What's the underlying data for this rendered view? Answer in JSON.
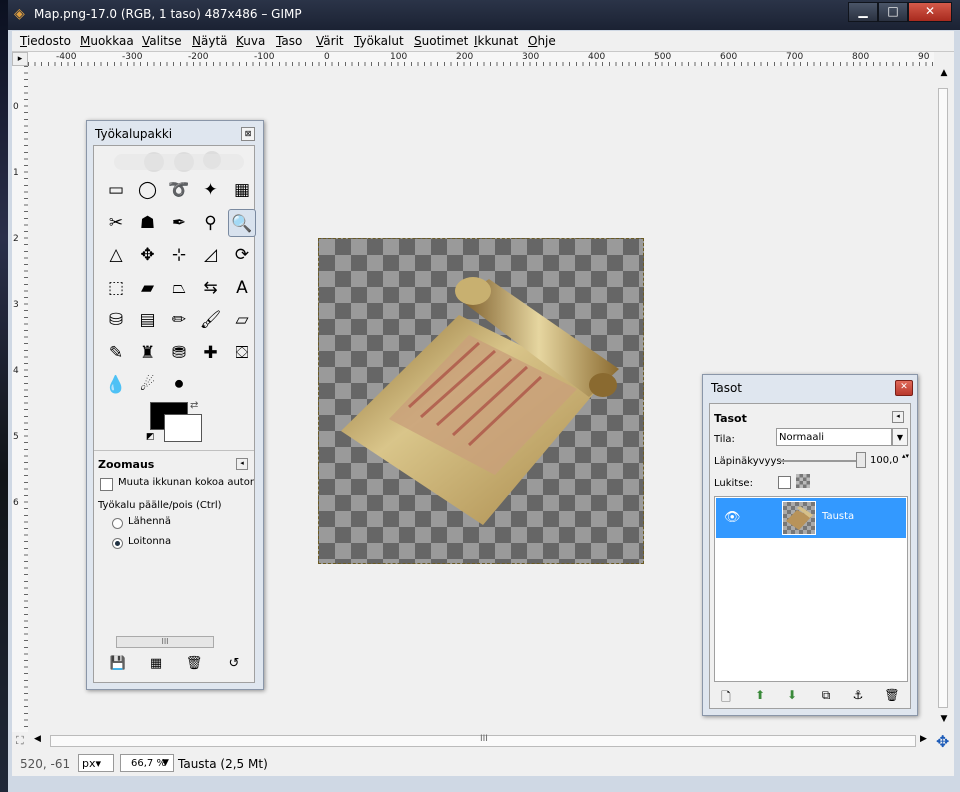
{
  "window": {
    "title": "Map.png-17.0 (RGB, 1 taso) 487x486 – GIMP",
    "minimize": "▁",
    "maximize": "□",
    "close": "✕"
  },
  "menu": [
    "Tiedosto",
    "Muokkaa",
    "Valitse",
    "Näytä",
    "Kuva",
    "Taso",
    "Värit",
    "Työkalut",
    "Suotimet",
    "Ikkunat",
    "Ohje"
  ],
  "ruler": {
    "h_labels": [
      "-400",
      "-300",
      "-200",
      "-100",
      "0",
      "100",
      "200",
      "300",
      "400",
      "500",
      "600",
      "700",
      "800",
      "90"
    ],
    "v_labels": [
      "0",
      "1",
      "2",
      "3",
      "4",
      "5",
      "6"
    ]
  },
  "status": {
    "coords": "520, -61",
    "unit": "px▾",
    "zoom": "66,7 %",
    "text": "Tausta (2,5 Mt)"
  },
  "toolbox": {
    "title": "Työkalupakki",
    "close": "⊠",
    "tools": [
      {
        "name": "rect-select-icon",
        "glyph": "▭"
      },
      {
        "name": "ellipse-select-icon",
        "glyph": "◯"
      },
      {
        "name": "free-select-icon",
        "glyph": "➰"
      },
      {
        "name": "fuzzy-select-icon",
        "glyph": "✦"
      },
      {
        "name": "color-select-icon",
        "glyph": "▦"
      },
      {
        "name": "scissors-icon",
        "glyph": "✂"
      },
      {
        "name": "foreground-select-icon",
        "glyph": "☗"
      },
      {
        "name": "paths-icon",
        "glyph": "✒"
      },
      {
        "name": "color-picker-icon",
        "glyph": "⚲"
      },
      {
        "name": "zoom-icon",
        "glyph": "🔍"
      },
      {
        "name": "measure-icon",
        "glyph": "△"
      },
      {
        "name": "move-icon",
        "glyph": "✥"
      },
      {
        "name": "align-icon",
        "glyph": "⊹"
      },
      {
        "name": "crop-icon",
        "glyph": "◿"
      },
      {
        "name": "rotate-icon",
        "glyph": "⟳"
      },
      {
        "name": "scale-icon",
        "glyph": "⬚"
      },
      {
        "name": "shear-icon",
        "glyph": "▰"
      },
      {
        "name": "perspective-icon",
        "glyph": "⏢"
      },
      {
        "name": "flip-icon",
        "glyph": "⇆"
      },
      {
        "name": "text-icon",
        "glyph": "A"
      },
      {
        "name": "bucket-fill-icon",
        "glyph": "⛁"
      },
      {
        "name": "blend-icon",
        "glyph": "▤"
      },
      {
        "name": "pencil-icon",
        "glyph": "✏"
      },
      {
        "name": "paintbrush-icon",
        "glyph": "🖌"
      },
      {
        "name": "eraser-icon",
        "glyph": "▱"
      },
      {
        "name": "airbrush-icon",
        "glyph": "✎"
      },
      {
        "name": "ink-icon",
        "glyph": "♜"
      },
      {
        "name": "clone-icon",
        "glyph": "⛃"
      },
      {
        "name": "heal-icon",
        "glyph": "✚"
      },
      {
        "name": "perspective-clone-icon",
        "glyph": "⛋"
      },
      {
        "name": "blur-icon",
        "glyph": "💧"
      },
      {
        "name": "smudge-icon",
        "glyph": "☄"
      },
      {
        "name": "dodge-burn-icon",
        "glyph": "⚫"
      }
    ],
    "swap_icon": "⇄",
    "reset_icon": "◩",
    "options_title": "Zoomaus",
    "menu_btn": "◂",
    "resize_label": "Muuta ikkunan kokoa automaattisesti",
    "toggle_label": "Työkalu päälle/pois  (Ctrl)",
    "zoom_in": "Lähennä",
    "zoom_out": "Loitonna",
    "scroll_grip": "III",
    "buttons": [
      "💾",
      "▦",
      "🗑",
      "↺"
    ]
  },
  "layers": {
    "title": "Tasot",
    "close": "✕",
    "header": "Tasot",
    "menu_btn": "◂",
    "mode_label": "Tila:",
    "mode_value": "Normaali",
    "mode_arrow": "▼",
    "opacity_label": "Läpinäkyvyys:",
    "opacity_value": "100,0",
    "opacity_spin": "▴▾",
    "lock_label": "Lukitse:",
    "layer_name": "Tausta",
    "eye": "👁",
    "buttons": [
      "🗋",
      "⬆",
      "⬇",
      "⧉",
      "⚓",
      "🗑"
    ]
  },
  "scroll": {
    "up": "▲",
    "down": "▼",
    "left": "◀",
    "right": "▶",
    "grip": "III",
    "quickmask": "⛶",
    "navigate": "✥"
  }
}
